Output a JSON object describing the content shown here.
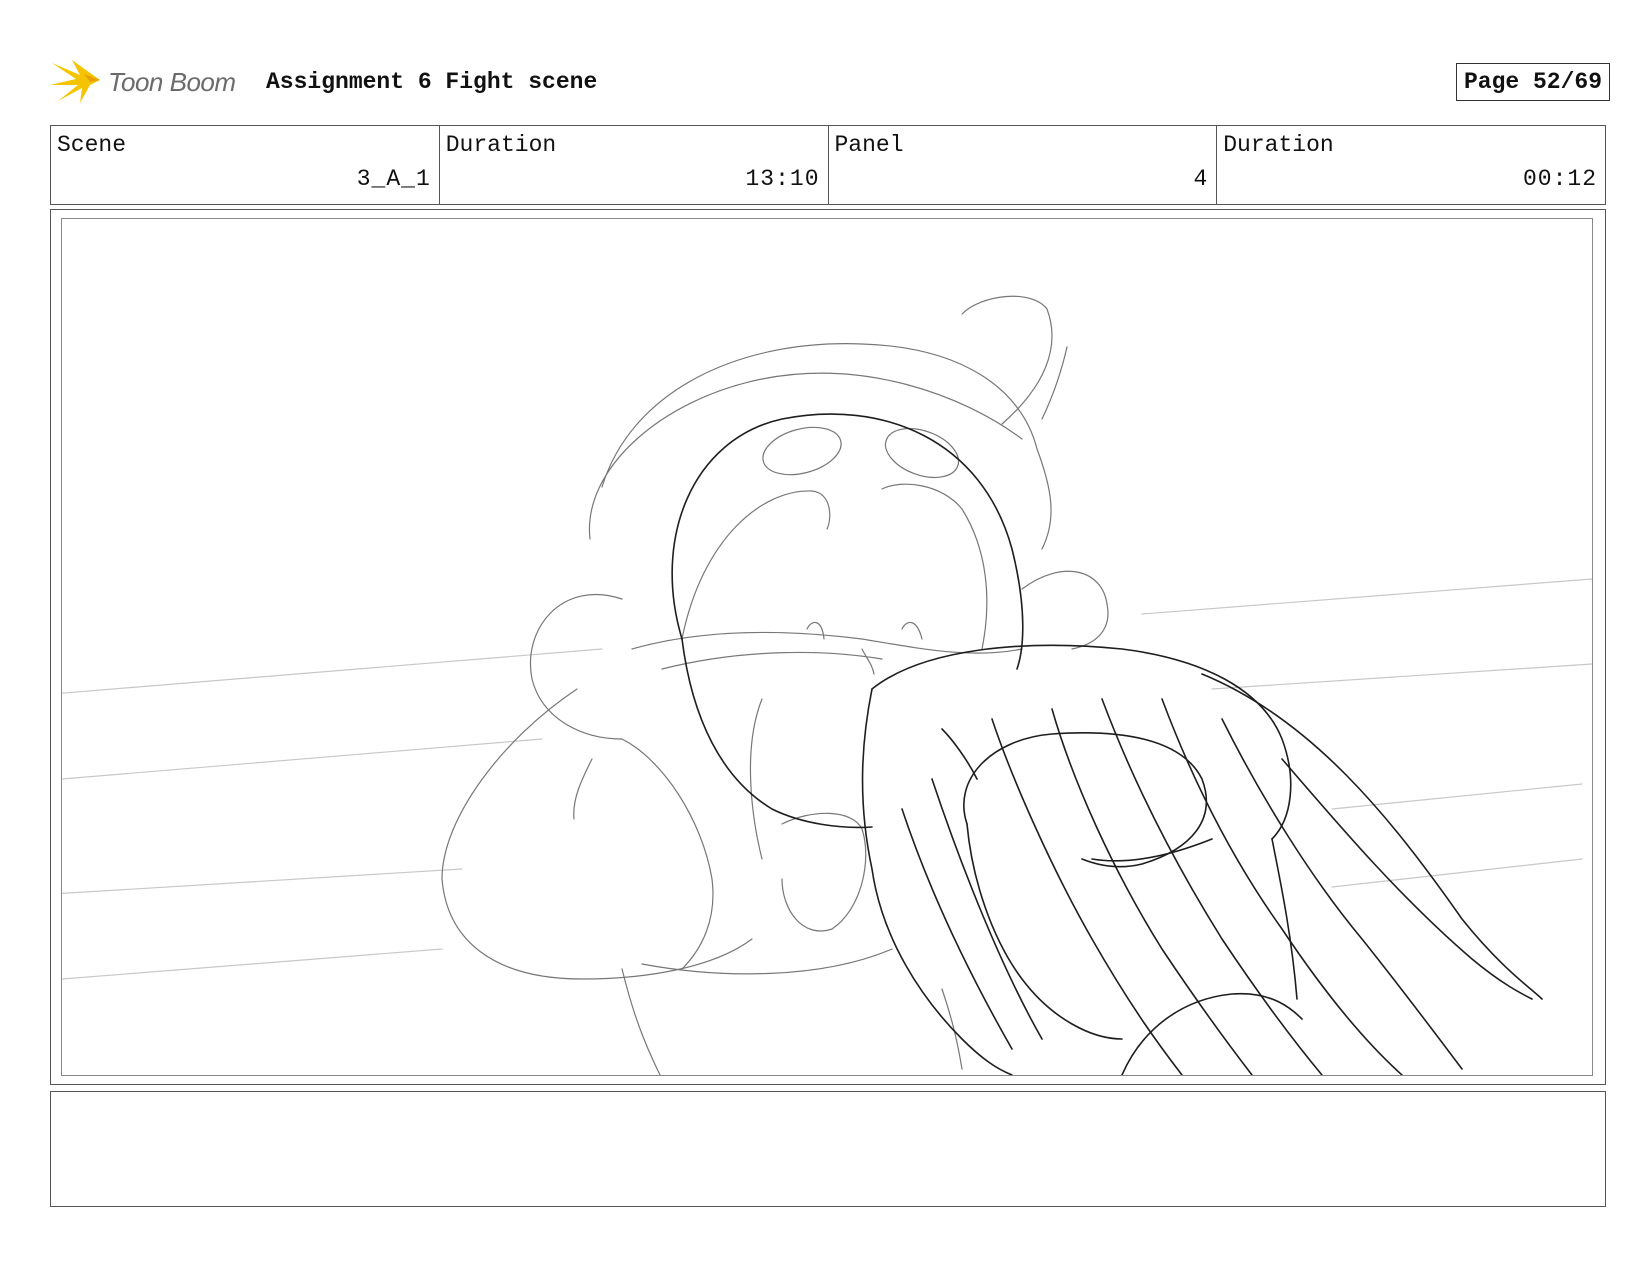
{
  "header": {
    "brand": "Toon Boom",
    "title": "Assignment 6 Fight scene",
    "page": "Page 52/69",
    "logo_color": "#f5c400"
  },
  "info": {
    "scene_label": "Scene",
    "scene_value": "3_A_1",
    "scene_duration_label": "Duration",
    "scene_duration_value": "13:10",
    "panel_label": "Panel",
    "panel_value": "4",
    "panel_duration_label": "Duration",
    "panel_duration_value": "00:12"
  },
  "panel": {
    "image": "sketch-drawing",
    "notes": ""
  }
}
